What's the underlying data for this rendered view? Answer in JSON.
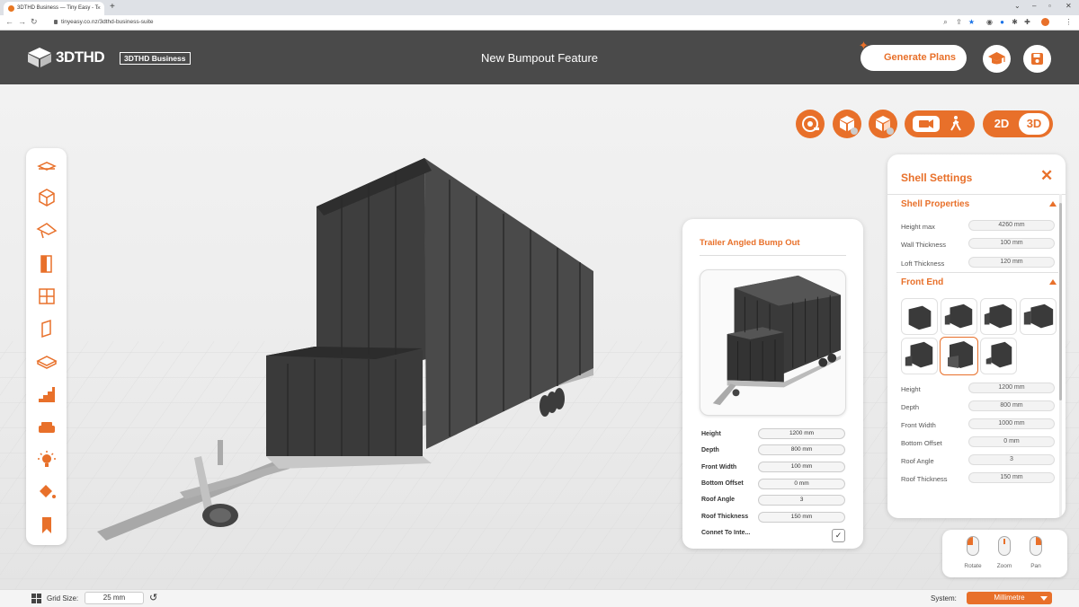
{
  "browser": {
    "tab_title": "3DTHD Business — Tiny Easy - T",
    "url": "tinyeasy.co.nz/3dthd-business-suite",
    "new_tab": "+"
  },
  "header": {
    "logo_text": "3DTHD",
    "logo_badge": "3DTHD Business",
    "title": "New Bumpout Feature",
    "generate_label": "Generate Plans",
    "icons": [
      "graduation-cap-icon",
      "save-icon"
    ]
  },
  "view_toggle": {
    "two_d": "2D",
    "three_d": "3D"
  },
  "sidebar_icons": [
    "trailer-icon",
    "cube-icon",
    "roof-icon",
    "door-icon",
    "window-icon",
    "wall-panel-icon",
    "floor-icon",
    "stairs-icon",
    "sofa-icon",
    "light-icon",
    "paint-bucket-icon",
    "bookmark-icon"
  ],
  "bumpout": {
    "title": "Trailer Angled Bump Out",
    "fields": [
      {
        "label": "Height",
        "value": "1200 mm"
      },
      {
        "label": "Depth",
        "value": "800 mm"
      },
      {
        "label": "Front Width",
        "value": "100 mm"
      },
      {
        "label": "Bottom Offset",
        "value": "0 mm"
      },
      {
        "label": "Roof Angle",
        "value": "3"
      },
      {
        "label": "Roof Thickness",
        "value": "150 mm"
      }
    ],
    "connect_label": "Connet To Inte...",
    "connect_checked": "✓"
  },
  "shell": {
    "title": "Shell Settings",
    "close": "✕",
    "section1": "Shell Properties",
    "props": [
      {
        "label": "Height max",
        "value": "4260 mm"
      },
      {
        "label": "Wall Thickness",
        "value": "100 mm"
      },
      {
        "label": "Loft Thickness",
        "value": "120 mm"
      }
    ],
    "section2": "Front End",
    "front": [
      {
        "label": "Height",
        "value": "1200 mm"
      },
      {
        "label": "Depth",
        "value": "800 mm"
      },
      {
        "label": "Front Width",
        "value": "1000 mm"
      },
      {
        "label": "Bottom Offset",
        "value": "0 mm"
      },
      {
        "label": "Roof Angle",
        "value": "3"
      },
      {
        "label": "Roof Thickness",
        "value": "150 mm"
      }
    ]
  },
  "camera": {
    "rotate": "Rotate",
    "zoom": "Zoom",
    "pan": "Pan"
  },
  "status": {
    "grid_label": "Grid Size:",
    "grid_value": "25 mm",
    "system_label": "System:",
    "system_value": "Millimetre"
  },
  "colors": {
    "accent": "#e8702a",
    "header": "#4a4a4a"
  }
}
